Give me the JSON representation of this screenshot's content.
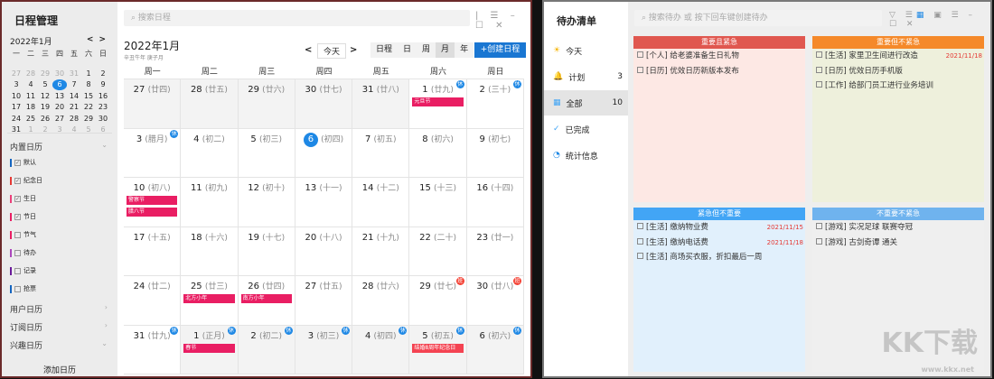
{
  "calendar": {
    "app_title": "日程管理",
    "mini": {
      "month": "2022年1月",
      "prev": "<",
      "next": ">",
      "weekdays": [
        "一",
        "二",
        "三",
        "四",
        "五",
        "六",
        "日"
      ],
      "days": [
        "27",
        "28",
        "29",
        "30",
        "31",
        "1",
        "2",
        "3",
        "4",
        "5",
        "6",
        "7",
        "8",
        "9",
        "10",
        "11",
        "12",
        "13",
        "14",
        "15",
        "16",
        "17",
        "18",
        "19",
        "20",
        "21",
        "22",
        "23",
        "24",
        "25",
        "26",
        "27",
        "28",
        "29",
        "30",
        "31",
        "1",
        "2",
        "3",
        "4",
        "5",
        "6"
      ],
      "today": "6"
    },
    "sections": {
      "builtin": "内置日历",
      "user": "用户日历",
      "subscribe": "订阅日历",
      "interest": "兴趣日历"
    },
    "calendars": [
      {
        "label": "默认",
        "color": "#1565c0",
        "checked": true
      },
      {
        "label": "纪念日",
        "color": "#e53935",
        "checked": true
      },
      {
        "label": "生日",
        "color": "#ec407a",
        "checked": true
      },
      {
        "label": "节日",
        "color": "#e91e63",
        "checked": true
      },
      {
        "label": "节气",
        "color": "#e91e63",
        "checked": false
      },
      {
        "label": "待办",
        "color": "#ab47bc",
        "checked": false
      },
      {
        "label": "记录",
        "color": "#6a1b9a",
        "checked": false
      },
      {
        "label": "抢票",
        "color": "#1565c0",
        "checked": false
      }
    ],
    "add_calendar": "添加日历",
    "search_placeholder": "搜索日程",
    "title": "2022年1月",
    "subtitle": "辛丑牛年 庚子月",
    "prev": "<",
    "next": ">",
    "today": "今天",
    "views": [
      "日程",
      "日",
      "周",
      "月",
      "年"
    ],
    "active_view": "月",
    "create": "+创建日程",
    "weekdays": [
      "周一",
      "周二",
      "周三",
      "周四",
      "周五",
      "周六",
      "周日"
    ],
    "cells": [
      {
        "d": "27",
        "l": "(廿四)",
        "o": true
      },
      {
        "d": "28",
        "l": "(廿五)",
        "o": true
      },
      {
        "d": "29",
        "l": "(廿六)",
        "o": true
      },
      {
        "d": "30",
        "l": "(廿七)",
        "o": true
      },
      {
        "d": "31",
        "l": "(廿八)",
        "o": true
      },
      {
        "d": "1",
        "l": "(廿九)",
        "b": "休",
        "ev": [
          "元旦节"
        ]
      },
      {
        "d": "2",
        "l": "(三十)",
        "b": "休"
      },
      {
        "d": "3",
        "l": "(腊月)",
        "b": "休"
      },
      {
        "d": "4",
        "l": "(初二)"
      },
      {
        "d": "5",
        "l": "(初三)"
      },
      {
        "d": "6",
        "l": "(初四)",
        "t": true
      },
      {
        "d": "7",
        "l": "(初五)"
      },
      {
        "d": "8",
        "l": "(初六)"
      },
      {
        "d": "9",
        "l": "(初七)"
      },
      {
        "d": "10",
        "l": "(初八)",
        "ev": [
          "警察节",
          "腊八节"
        ]
      },
      {
        "d": "11",
        "l": "(初九)"
      },
      {
        "d": "12",
        "l": "(初十)"
      },
      {
        "d": "13",
        "l": "(十一)"
      },
      {
        "d": "14",
        "l": "(十二)"
      },
      {
        "d": "15",
        "l": "(十三)"
      },
      {
        "d": "16",
        "l": "(十四)"
      },
      {
        "d": "17",
        "l": "(十五)"
      },
      {
        "d": "18",
        "l": "(十六)"
      },
      {
        "d": "19",
        "l": "(十七)"
      },
      {
        "d": "20",
        "l": "(十八)"
      },
      {
        "d": "21",
        "l": "(十九)"
      },
      {
        "d": "22",
        "l": "(二十)"
      },
      {
        "d": "23",
        "l": "(廿一)"
      },
      {
        "d": "24",
        "l": "(廿二)"
      },
      {
        "d": "25",
        "l": "(廿三)",
        "ev": [
          "北方小年"
        ]
      },
      {
        "d": "26",
        "l": "(廿四)",
        "ev": [
          "南方小年"
        ]
      },
      {
        "d": "27",
        "l": "(廿五)"
      },
      {
        "d": "28",
        "l": "(廿六)"
      },
      {
        "d": "29",
        "l": "(廿七)",
        "b": "班"
      },
      {
        "d": "30",
        "l": "(廿八)",
        "b": "班"
      },
      {
        "d": "31",
        "l": "(廿九)",
        "b": "休"
      },
      {
        "d": "1",
        "l": "(正月)",
        "o": true,
        "b": "休",
        "ev": [
          "春节"
        ]
      },
      {
        "d": "2",
        "l": "(初二)",
        "o": true,
        "b": "休"
      },
      {
        "d": "3",
        "l": "(初三)",
        "o": true,
        "b": "休"
      },
      {
        "d": "4",
        "l": "(初四)",
        "o": true,
        "b": "休"
      },
      {
        "d": "5",
        "l": "(初五)",
        "o": true,
        "b": "休",
        "ev": [
          "结婚8周年纪念日"
        ]
      },
      {
        "d": "6",
        "l": "(初六)",
        "o": true,
        "b": "休"
      }
    ],
    "colors": {
      "accent": "#1e88e5",
      "holiday": "#e91e63",
      "anniversary": "#f44352",
      "work": "#f44336"
    }
  },
  "todo": {
    "app_title": "待办清单",
    "nav": [
      {
        "label": "今天",
        "icon": "☀",
        "count": ""
      },
      {
        "label": "计划",
        "icon": "🔔",
        "count": "3"
      },
      {
        "label": "全部",
        "icon": "▦",
        "count": "10"
      },
      {
        "label": "已完成",
        "icon": "✓",
        "count": ""
      },
      {
        "label": "统计信息",
        "icon": "◔",
        "count": ""
      }
    ],
    "search_placeholder": "搜索待办 或 按下回车键创建待办",
    "quadrants": [
      {
        "title": "重要且紧急",
        "color": "#e0574f",
        "bg": "#fde8e4",
        "items": [
          {
            "text": "[个人] 给老婆准备生日礼物",
            "date": ""
          },
          {
            "text": "[日历] 优效日历新版本发布",
            "date": ""
          }
        ]
      },
      {
        "title": "重要但不紧急",
        "color": "#f5892a",
        "bg": "#eef0dc",
        "items": [
          {
            "text": "[生活] 家里卫生间进行改造",
            "date": "2021/11/18"
          },
          {
            "text": "[日历] 优效日历手机版",
            "date": ""
          },
          {
            "text": "[工作] 给部门员工进行业务培训",
            "date": ""
          }
        ]
      },
      {
        "title": "紧急但不重要",
        "color": "#42a5f5",
        "bg": "#e1f0fc",
        "items": [
          {
            "text": "[生活] 缴纳物业费",
            "date": "2021/11/15"
          },
          {
            "text": "[生活] 缴纳电话费",
            "date": "2021/11/18"
          },
          {
            "text": "[生活] 商场买衣服，折扣最后一周",
            "date": ""
          }
        ]
      },
      {
        "title": "不重要不紧急",
        "color": "#6fb3ee",
        "bg": "#efefef",
        "items": [
          {
            "text": "[游戏] 实况足球 联赛夺冠",
            "date": ""
          },
          {
            "text": "[游戏] 古剑奇谭 通关",
            "date": ""
          }
        ]
      }
    ]
  },
  "watermark": {
    "text": "KK下载",
    "url": "www.kkx.net"
  }
}
